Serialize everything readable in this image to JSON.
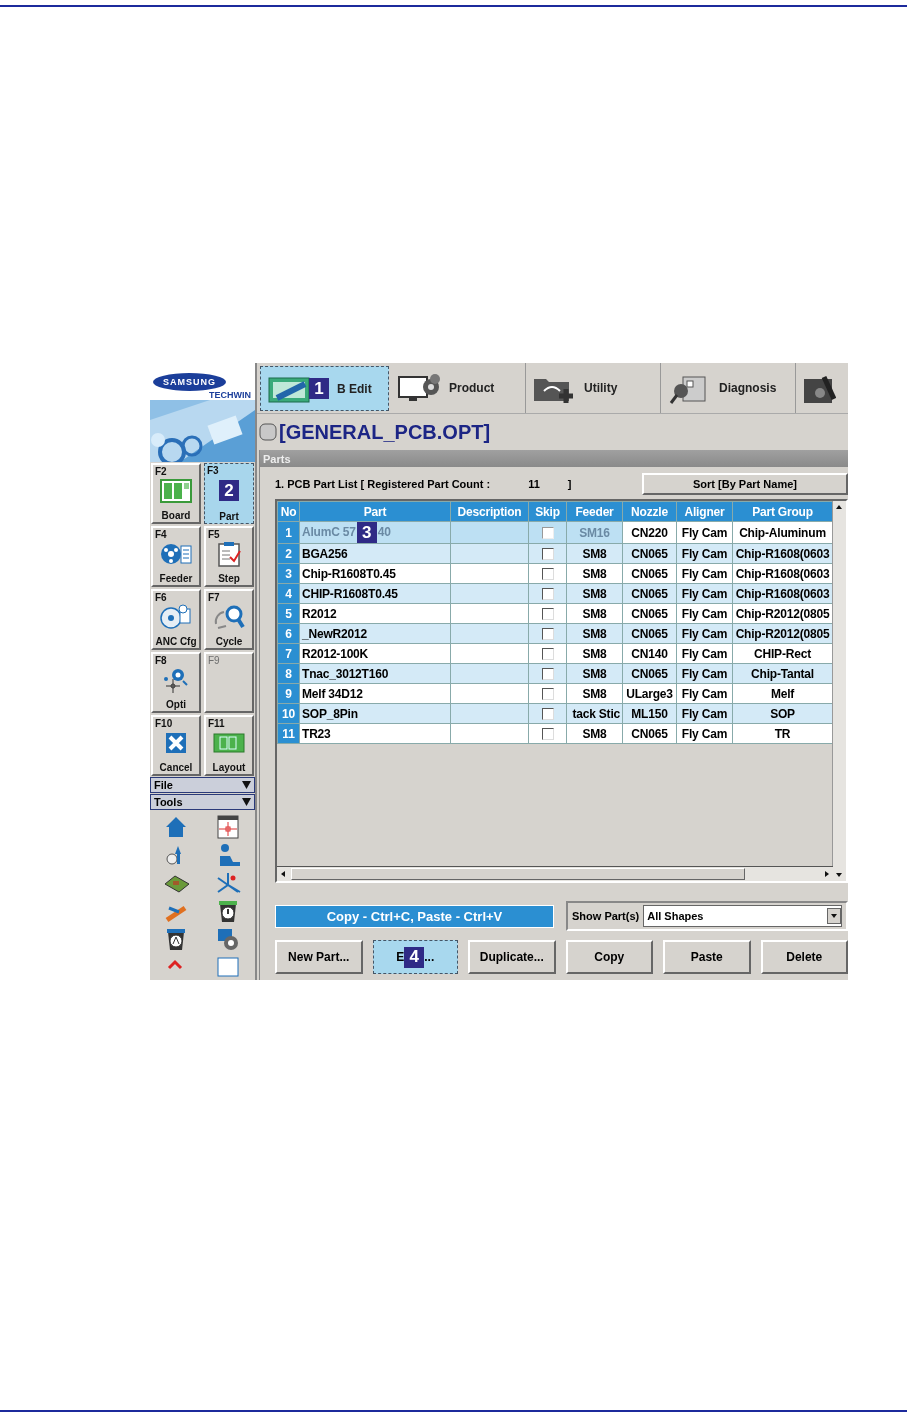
{
  "logo": {
    "brand": "SAMSUNG",
    "sub": "TECHWIN"
  },
  "function_keys": [
    {
      "key": "F2",
      "label": "Board",
      "selected": false,
      "disabled": false
    },
    {
      "key": "F3",
      "label": "Part",
      "selected": true,
      "disabled": false,
      "callout": "2"
    },
    {
      "key": "F4",
      "label": "Feeder",
      "selected": false,
      "disabled": false
    },
    {
      "key": "F5",
      "label": "Step",
      "selected": false,
      "disabled": false
    },
    {
      "key": "F6",
      "label": "ANC Cfg",
      "selected": false,
      "disabled": false
    },
    {
      "key": "F7",
      "label": "Cycle",
      "selected": false,
      "disabled": false
    },
    {
      "key": "F8",
      "label": "Opti",
      "selected": false,
      "disabled": false
    },
    {
      "key": "F9",
      "selected": false,
      "disabled": true
    },
    {
      "key": "F10",
      "label": "Cancel",
      "selected": false,
      "disabled": false
    },
    {
      "key": "F11",
      "label": "Layout",
      "selected": false,
      "disabled": false
    }
  ],
  "menus": [
    {
      "label": "File"
    },
    {
      "label": "Tools"
    }
  ],
  "toolbar": [
    {
      "label": "B Edit",
      "selected": true,
      "callout": "1"
    },
    {
      "label": "Product",
      "selected": false
    },
    {
      "label": "Utility",
      "selected": false
    },
    {
      "label": "Diagnosis",
      "selected": false
    }
  ],
  "file_title": "[GENERAL_PCB.OPT]",
  "panel": {
    "title": "Parts",
    "list_label": "1. PCB Part List  [ Registered Part Count :",
    "count": "11",
    "list_close": "]",
    "sort_button": "Sort [By Part Name]"
  },
  "table": {
    "columns": [
      "No",
      "Part",
      "Description",
      "Skip",
      "Feeder",
      "Nozzle",
      "Aligner",
      "Part Group"
    ],
    "rows": [
      {
        "no": "1",
        "part": "AlumC 57",
        "callout": "3",
        "part_tail": "40",
        "skip": false,
        "feeder": "SM16",
        "nozzle": "CN220",
        "aligner": "Fly Cam",
        "group": "Chip-Aluminum",
        "selected": true
      },
      {
        "no": "2",
        "part": "BGA256",
        "skip": false,
        "feeder": "SM8",
        "nozzle": "CN065",
        "aligner": "Fly Cam",
        "group": "Chip-R1608(0603",
        "selected": false
      },
      {
        "no": "3",
        "part": "Chip-R1608T0.45",
        "skip": false,
        "feeder": "SM8",
        "nozzle": "CN065",
        "aligner": "Fly Cam",
        "group": "Chip-R1608(0603",
        "selected": false
      },
      {
        "no": "4",
        "part": "CHIP-R1608T0.45",
        "skip": false,
        "feeder": "SM8",
        "nozzle": "CN065",
        "aligner": "Fly Cam",
        "group": "Chip-R1608(0603",
        "selected": false
      },
      {
        "no": "5",
        "part": "R2012",
        "skip": false,
        "feeder": "SM8",
        "nozzle": "CN065",
        "aligner": "Fly Cam",
        "group": "Chip-R2012(0805",
        "selected": false
      },
      {
        "no": "6",
        "part": "_NewR2012",
        "skip": false,
        "feeder": "SM8",
        "nozzle": "CN065",
        "aligner": "Fly Cam",
        "group": "Chip-R2012(0805",
        "selected": false
      },
      {
        "no": "7",
        "part": "R2012-100K",
        "skip": false,
        "feeder": "SM8",
        "nozzle": "CN140",
        "aligner": "Fly Cam",
        "group": "CHIP-Rect",
        "selected": false
      },
      {
        "no": "8",
        "part": "Tnac_3012T160",
        "skip": false,
        "feeder": "SM8",
        "nozzle": "CN065",
        "aligner": "Fly Cam",
        "group": "Chip-Tantal",
        "selected": false
      },
      {
        "no": "9",
        "part": "Melf 34D12",
        "skip": false,
        "feeder": "SM8",
        "nozzle": "ULarge3",
        "aligner": "Fly Cam",
        "group": "Melf",
        "selected": false
      },
      {
        "no": "10",
        "part": "SOP_8Pin",
        "skip": false,
        "feeder": "tack Stic",
        "nozzle": "ML150",
        "aligner": "Fly Cam",
        "group": "SOP",
        "selected": false
      },
      {
        "no": "11",
        "part": "TR23",
        "skip": false,
        "feeder": "SM8",
        "nozzle": "CN065",
        "aligner": "Fly Cam",
        "group": "TR",
        "selected": false
      }
    ]
  },
  "hint_bar": "Copy - Ctrl+C,  Paste - Ctrl+V",
  "show_parts": {
    "label": "Show Part(s)",
    "value": "All Shapes"
  },
  "buttons": [
    {
      "label": "New Part...",
      "selected": false
    },
    {
      "label": "E",
      "callout": "4",
      "tail": "...",
      "selected": true
    },
    {
      "label": "Duplicate...",
      "selected": false
    },
    {
      "label": "Copy",
      "selected": false
    },
    {
      "label": "Paste",
      "selected": false
    },
    {
      "label": "Delete",
      "selected": false
    }
  ]
}
